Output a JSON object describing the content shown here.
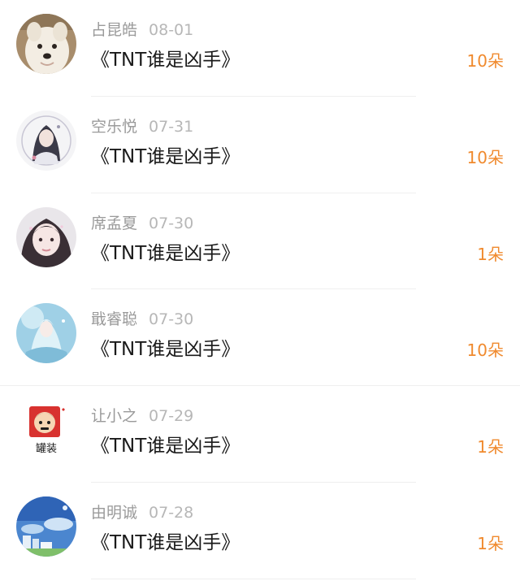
{
  "gifts": [
    {
      "name": "占昆皓",
      "date": "08-01",
      "title": "《TNT谁是凶手》",
      "amount": "10朵",
      "avatar": "white-dog-avatar"
    },
    {
      "name": "空乐悦",
      "date": "07-31",
      "title": "《TNT谁是凶手》",
      "amount": "10朵",
      "avatar": "anime-character-avatar"
    },
    {
      "name": "席孟夏",
      "date": "07-30",
      "title": "《TNT谁是凶手》",
      "amount": "1朵",
      "avatar": "girl-photo-avatar"
    },
    {
      "name": "戢睿聪",
      "date": "07-30",
      "title": "《TNT谁是凶手》",
      "amount": "10朵",
      "avatar": "fairy-blue-avatar"
    },
    {
      "name": "让小之",
      "date": "07-29",
      "title": "《TNT谁是凶手》",
      "amount": "1朵",
      "avatar": "cartoon-can-avatar",
      "avatar_text": "罐装"
    },
    {
      "name": "由明诚",
      "date": "07-28",
      "title": "《TNT谁是凶手》",
      "amount": "1朵",
      "avatar": "sky-city-avatar"
    }
  ],
  "colors": {
    "name": "#9a9a9a",
    "date": "#b7b7b7",
    "title": "#1a1a1a",
    "amount": "#f08a2e",
    "divider": "#efefef"
  }
}
